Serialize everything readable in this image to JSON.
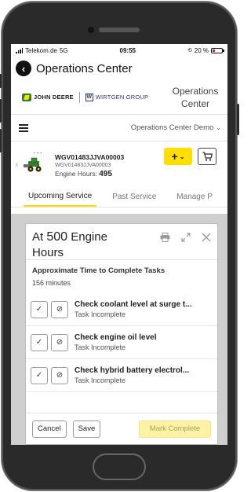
{
  "status_bar": {
    "carrier": "Telekom.de",
    "network": "5G",
    "time": "09:55",
    "battery": "20 %"
  },
  "app": {
    "title": "Operations Center"
  },
  "brand": {
    "john_deere": "JOHN DEERE",
    "wirtgen": "WIRTGEN GROUP",
    "product_title": "Operations Center"
  },
  "org": {
    "selected": "Operations Center Demo"
  },
  "machine": {
    "name": "WGV01483JJVA00003",
    "serial": "WGV01483JJVA00003",
    "hours_label": "Engine Hours:",
    "hours_value": "495",
    "more": "···"
  },
  "tabs": [
    {
      "label": "Upcoming Service",
      "active": true
    },
    {
      "label": "Past Service",
      "active": false
    },
    {
      "label": "Manage P",
      "active": false
    }
  ],
  "modal": {
    "title_prefix": "At",
    "title_number": "500",
    "title_suffix": "Engine Hours",
    "approx_label": "Approximate Time to Complete Tasks",
    "approx_value": "156 minutes",
    "tasks": [
      {
        "name": "Check coolant level at surge t...",
        "status": "Task Incomplete"
      },
      {
        "name": "Check engine oil level",
        "status": "Task Incomplete"
      },
      {
        "name": "Check hybrid battery electrol...",
        "status": "Task Incomplete"
      }
    ],
    "cancel_label": "Cancel",
    "save_label": "Save",
    "complete_label": "Mark Complete"
  },
  "colors": {
    "accent": "#ffde00",
    "deere_green": "#367c2b"
  }
}
